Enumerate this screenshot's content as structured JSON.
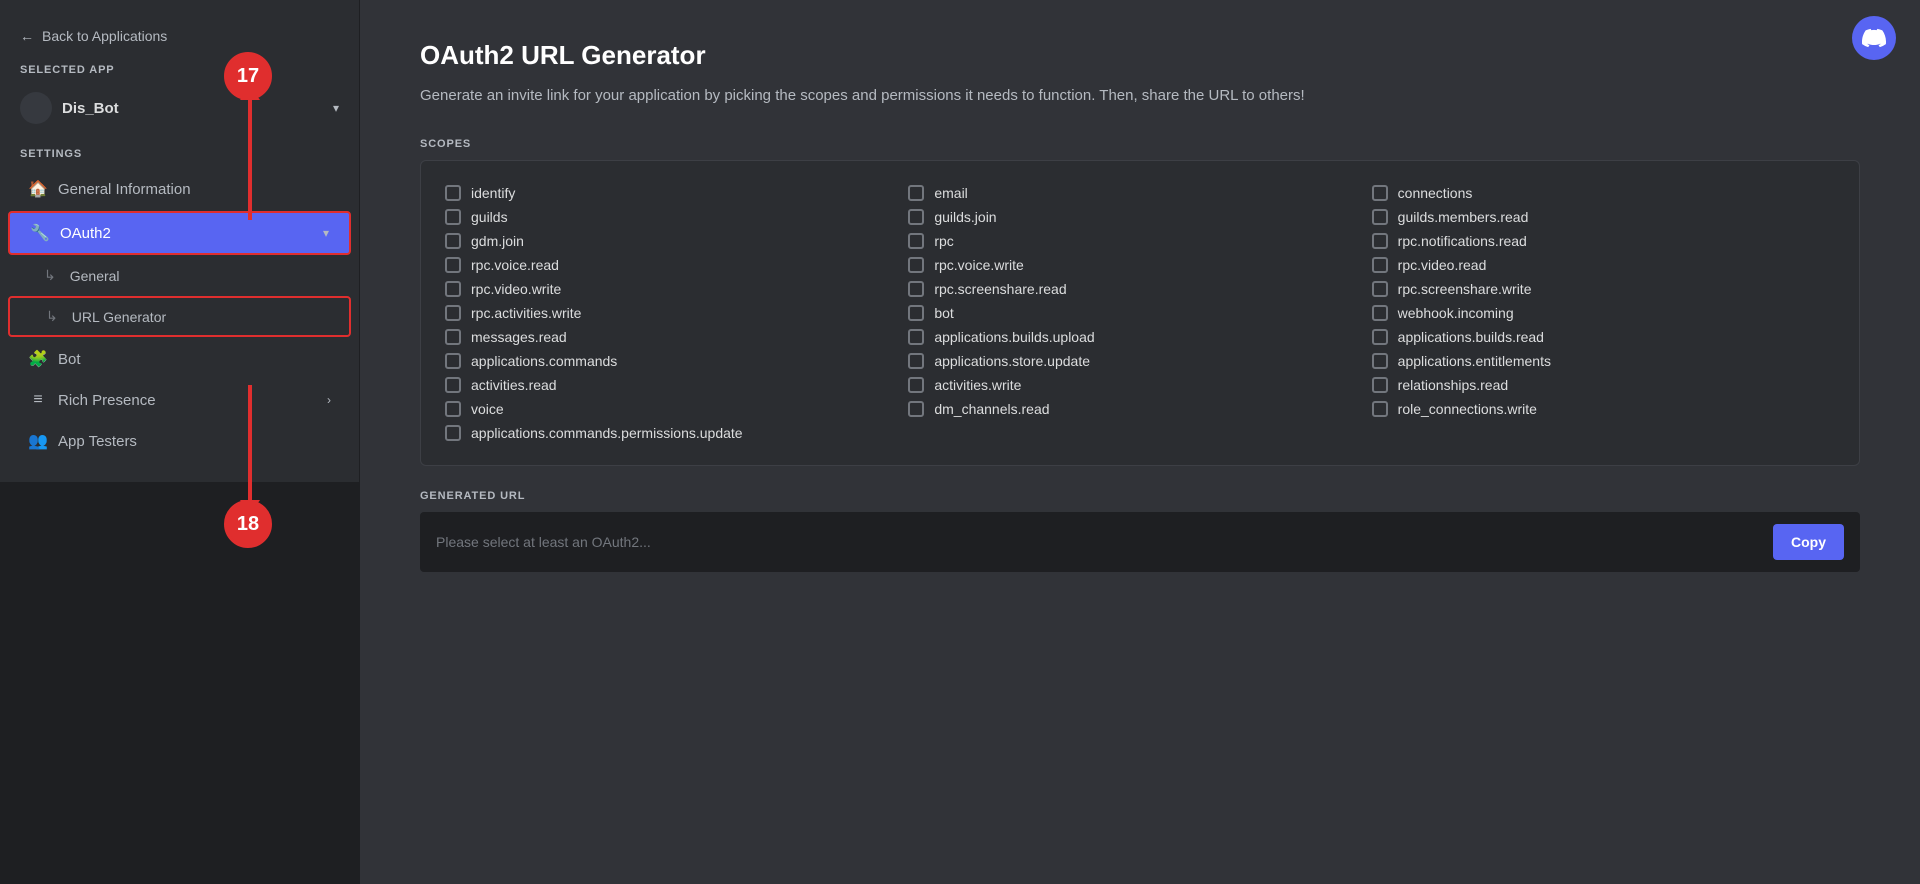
{
  "sidebar": {
    "back_label": "Back to Applications",
    "selected_app_label": "SELECTED APP",
    "app_name": "Dis_Bot",
    "settings_label": "SETTINGS",
    "nav_items": [
      {
        "id": "general-information",
        "label": "General Information",
        "icon": "🏠",
        "active": false
      },
      {
        "id": "oauth2",
        "label": "OAuth2",
        "icon": "🔧",
        "active": true,
        "has_dropdown": true
      },
      {
        "id": "oauth2-general",
        "label": "General",
        "sub": true,
        "active": false
      },
      {
        "id": "oauth2-url-generator",
        "label": "URL Generator",
        "sub": true,
        "active": true
      },
      {
        "id": "bot",
        "label": "Bot",
        "icon": "🧩",
        "active": false
      },
      {
        "id": "rich-presence",
        "label": "Rich Presence",
        "icon": "≡",
        "active": false,
        "has_arrow": true
      },
      {
        "id": "app-testers",
        "label": "App Testers",
        "icon": "👥",
        "active": false
      }
    ]
  },
  "main": {
    "title": "OAuth2 URL Generator",
    "description": "Generate an invite link for your application by picking the scopes and permissions it needs to function. Then, share the URL to others!",
    "scopes_label": "SCOPES",
    "scopes": [
      "identify",
      "guilds",
      "gdm.join",
      "rpc.voice.read",
      "rpc.video.write",
      "rpc.activities.write",
      "messages.read",
      "applications.commands",
      "activities.read",
      "voice",
      "applications.commands.permissions.update",
      "email",
      "guilds.join",
      "rpc",
      "rpc.voice.write",
      "rpc.screenshare.read",
      "",
      "bot",
      "applications.builds.upload",
      "activities.write",
      "dm_channels.read",
      "",
      "connections",
      "guilds.members.read",
      "rpc.notifications.read",
      "rpc.video.read",
      "rpc.screenshare.write",
      "",
      "webhook.incoming",
      "applications.builds.read",
      "applications.entitlements",
      "relationships.read",
      "role_connections.write",
      ""
    ],
    "scopes_col1": [
      "identify",
      "guilds",
      "gdm.join",
      "rpc.voice.read",
      "rpc.video.write",
      "rpc.activities.write",
      "messages.read",
      "applications.commands",
      "activities.read",
      "voice",
      "applications.commands.permissions.update"
    ],
    "scopes_col2": [
      "email",
      "guilds.join",
      "rpc",
      "rpc.voice.write",
      "rpc.screenshare.read",
      "bot",
      "applications.builds.upload",
      "applications.store.update",
      "activities.write",
      "dm_channels.read"
    ],
    "scopes_col3": [
      "connections",
      "guilds.members.read",
      "rpc.notifications.read",
      "rpc.video.read",
      "rpc.screenshare.write",
      "webhook.incoming",
      "applications.builds.read",
      "applications.entitlements",
      "relationships.read",
      "role_connections.write"
    ],
    "generated_url_label": "GENERATED URL",
    "url_placeholder": "Please select at least an OAuth2...",
    "copy_btn_label": "Copy"
  },
  "annotations": {
    "circle_17": "17",
    "circle_18": "18"
  }
}
